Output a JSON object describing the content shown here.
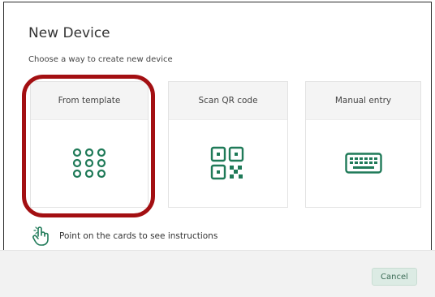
{
  "dialog": {
    "title": "New Device",
    "subtitle": "Choose a way to create new device"
  },
  "cards": [
    {
      "label": "From template",
      "icon": "grid-dots-icon"
    },
    {
      "label": "Scan QR code",
      "icon": "qr-code-icon"
    },
    {
      "label": "Manual entry",
      "icon": "keyboard-icon"
    }
  ],
  "hint": {
    "text": "Point on the cards to see instructions",
    "icon": "pointer-hand-icon"
  },
  "footer": {
    "cancel_label": "Cancel"
  },
  "colors": {
    "accent": "#1f7a58",
    "highlight": "#a30f12",
    "card_header": "#f4f4f4",
    "footer_bg": "#f2f2f2"
  }
}
